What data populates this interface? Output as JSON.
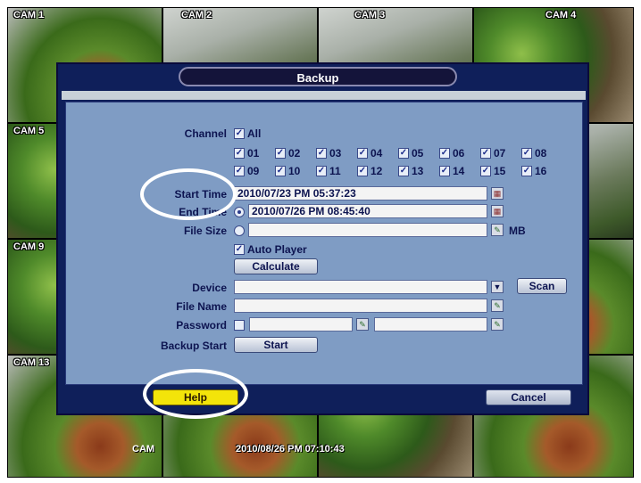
{
  "cameras": [
    "CAM 1",
    "CAM 2",
    "CAM 3",
    "CAM 4",
    "CAM 5",
    "CAM 9",
    "CAM 13"
  ],
  "osd": {
    "timestamp": "2010/08/26 PM 07:10:43",
    "small_label": "CAM"
  },
  "dialog": {
    "title": "Backup",
    "channel": {
      "label": "Channel",
      "all_label": "All",
      "channels": [
        "01",
        "02",
        "03",
        "04",
        "05",
        "06",
        "07",
        "08",
        "09",
        "10",
        "11",
        "12",
        "13",
        "14",
        "15",
        "16"
      ]
    },
    "start_time": {
      "label": "Start Time",
      "value": "2010/07/23 PM 05:37:23"
    },
    "end_time": {
      "label": "End Time",
      "value": "2010/07/26 PM 08:45:40"
    },
    "file_size": {
      "label": "File Size",
      "value": "",
      "unit": "MB"
    },
    "auto_player": {
      "label": "Auto Player"
    },
    "calculate_label": "Calculate",
    "device": {
      "label": "Device",
      "value": ""
    },
    "scan_label": "Scan",
    "file_name": {
      "label": "File Name",
      "value": ""
    },
    "password": {
      "label": "Password",
      "value": "",
      "confirm": ""
    },
    "backup_start": {
      "label": "Backup Start",
      "button": "Start"
    },
    "help_label": "Help",
    "cancel_label": "Cancel"
  }
}
